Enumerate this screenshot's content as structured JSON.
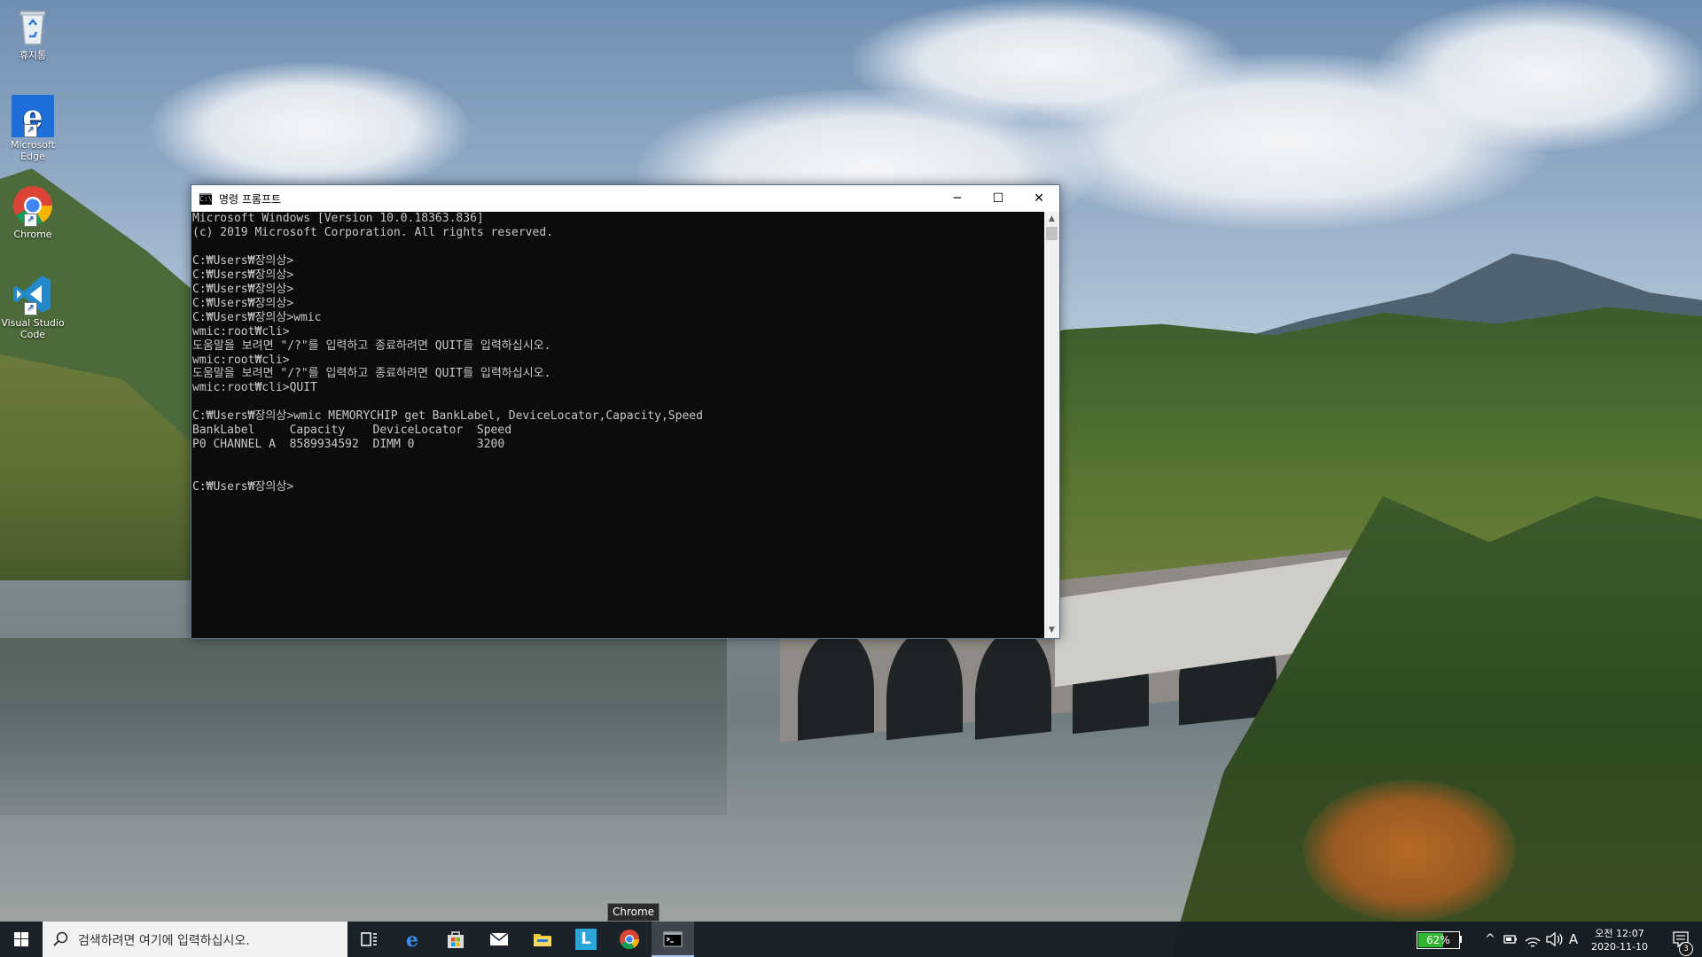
{
  "desktop": {
    "icons": [
      {
        "label": "휴지통",
        "icon": "recycle-bin-icon"
      },
      {
        "label": "Microsoft Edge",
        "icon": "edge-icon"
      },
      {
        "label": "Chrome",
        "icon": "chrome-icon"
      },
      {
        "label": "Visual Studio Code",
        "icon": "vscode-icon"
      }
    ]
  },
  "window": {
    "title": "명령 프롬프트",
    "controls": {
      "minimize": "─",
      "maximize": "☐",
      "close": "✕"
    },
    "scroll_up": "▲",
    "scroll_down": "▼",
    "console_lines": [
      "Microsoft Windows [Version 10.0.18363.836]",
      "(c) 2019 Microsoft Corporation. All rights reserved.",
      "",
      "C:₩Users₩장의상>",
      "C:₩Users₩장의상>",
      "C:₩Users₩장의상>",
      "C:₩Users₩장의상>",
      "C:₩Users₩장의상>wmic",
      "wmic:root₩cli>",
      "도움말을 보려면 \"/?\"를 입력하고 종료하려면 QUIT를 입력하십시오.",
      "wmic:root₩cli>",
      "도움말을 보려면 \"/?\"를 입력하고 종료하려면 QUIT를 입력하십시오.",
      "wmic:root₩cli>QUIT",
      "",
      "C:₩Users₩장의상>wmic MEMORYCHIP get BankLabel, DeviceLocator,Capacity,Speed",
      "BankLabel     Capacity    DeviceLocator  Speed",
      "P0 CHANNEL A  8589934592  DIMM 0         3200",
      "",
      "",
      "C:₩Users₩장의상>"
    ]
  },
  "tooltip": {
    "text": "Chrome"
  },
  "taskbar": {
    "search_placeholder": "검색하려면 여기에 입력하십시오.",
    "apps": [
      {
        "name": "task-view",
        "icon": "task-view-icon"
      },
      {
        "name": "edge",
        "icon": "edge-icon"
      },
      {
        "name": "store",
        "icon": "store-icon"
      },
      {
        "name": "mail",
        "icon": "mail-icon"
      },
      {
        "name": "file-explorer",
        "icon": "folder-icon"
      },
      {
        "name": "l-app",
        "icon": "l-app-icon",
        "glyph": "L"
      },
      {
        "name": "chrome",
        "icon": "chrome-icon"
      },
      {
        "name": "command-prompt",
        "icon": "cmd-icon",
        "active": true
      }
    ],
    "tray": {
      "battery_percent": "62%",
      "battery_level": 0.62,
      "battery_color": "#2fb52f",
      "chevron": "^",
      "ime": "A",
      "time": "오전 12:07",
      "date": "2020-11-10",
      "notification_count": "3"
    }
  }
}
